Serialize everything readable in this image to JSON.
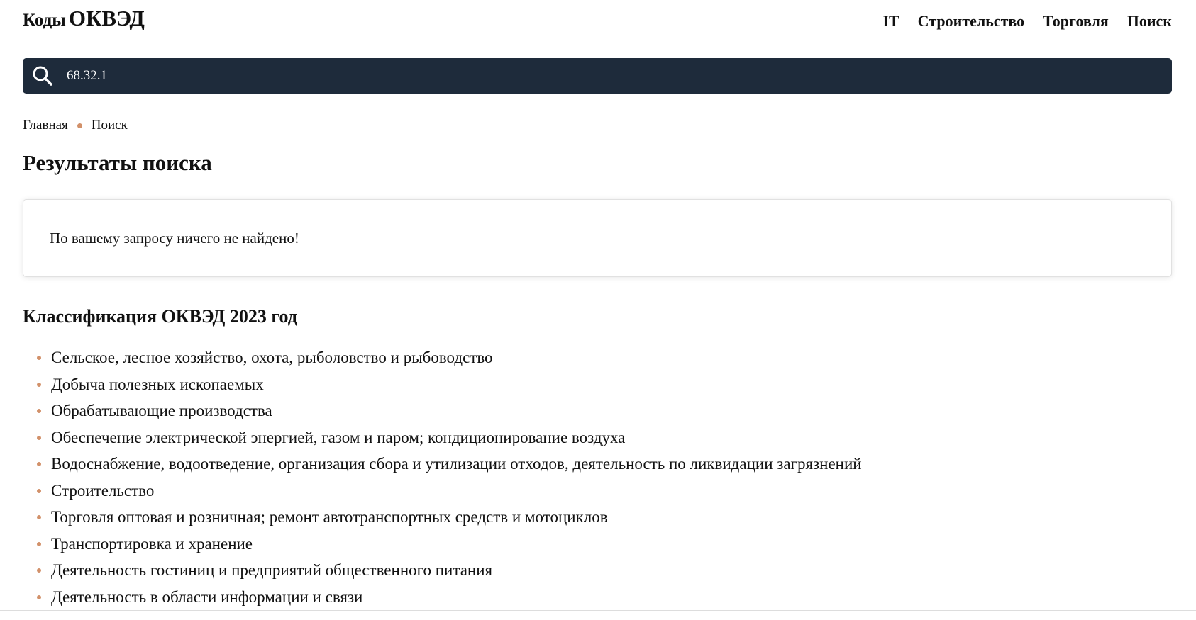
{
  "header": {
    "logo_part1": "Коды",
    "logo_part2": "ОКВЭД",
    "nav": [
      {
        "label": "IT"
      },
      {
        "label": "Строительство"
      },
      {
        "label": "Торговля"
      },
      {
        "label": "Поиск"
      }
    ]
  },
  "search": {
    "value": "68.32.1",
    "icon": "search-icon"
  },
  "breadcrumb": {
    "items": [
      {
        "label": "Главная"
      },
      {
        "label": "Поиск"
      }
    ]
  },
  "main": {
    "title": "Результаты поиска",
    "result_message": "По вашему запросу ничего не найдено!"
  },
  "classification": {
    "title": "Классификация ОКВЭД 2023 год",
    "items": [
      {
        "label": "Сельское, лесное хозяйство, охота, рыболовство и рыбоводство"
      },
      {
        "label": "Добыча полезных ископаемых"
      },
      {
        "label": "Обрабатывающие производства"
      },
      {
        "label": "Обеспечение электрической энергией, газом и паром; кондиционирование воздуха"
      },
      {
        "label": "Водоснабжение, водоотведение, организация сбора и утилизации отходов, деятельность по ликвидации загрязнений"
      },
      {
        "label": "Строительство"
      },
      {
        "label": "Торговля оптовая и розничная; ремонт автотранспортных средств и мотоциклов"
      },
      {
        "label": "Транспортировка и хранение"
      },
      {
        "label": "Деятельность гостиниц и предприятий общественного питания"
      },
      {
        "label": "Деятельность в области информации и связи"
      }
    ]
  },
  "colors": {
    "search_bar_bg": "#1e2b3b",
    "accent_bullet": "#d2916a",
    "text": "#111111"
  }
}
